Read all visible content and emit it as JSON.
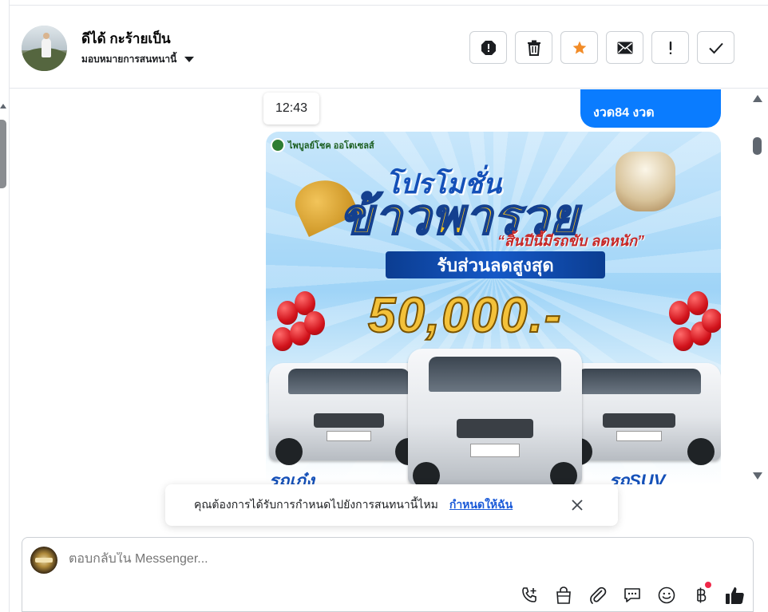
{
  "header": {
    "contact_name": "ดีได้ กะร้ายเป็น",
    "assign_label": "มอบหมายการสนทนานี้",
    "actions": [
      {
        "name": "block",
        "icon": "stop-octagon-icon"
      },
      {
        "name": "delete",
        "icon": "trash-icon"
      },
      {
        "name": "star",
        "icon": "star-icon"
      },
      {
        "name": "mark-unread",
        "icon": "envelope-icon"
      },
      {
        "name": "spam",
        "icon": "exclamation-icon"
      },
      {
        "name": "done",
        "icon": "check-icon"
      }
    ]
  },
  "conversation": {
    "timestamp": "12:43",
    "outgoing_message": "งวด84 งวด",
    "promo": {
      "brand": "ไพบูลย์โชค ออโตเซลส์",
      "title_a": "โปรโมชั่น",
      "title_b": "ข้าวพารวย",
      "subtitle": "“สิ้นปีนี้มีรถขับ ลดหนัก”",
      "band": "รับส่วนลดสูงสุด",
      "amount": "50,000.-",
      "label_left": "รถเก๋ง",
      "label_right": "รถSUV"
    }
  },
  "toast": {
    "text": "คุณต้องการได้รับการกำหนดไปยังการสนทนานี้ไหม",
    "link": "กำหนดให้ฉัน"
  },
  "composer": {
    "placeholder": "ตอบกลับใน Messenger...",
    "tools": [
      "call-add-icon",
      "shopping-bag-icon",
      "paperclip-icon",
      "chat-bubble-icon",
      "smiley-icon",
      "baht-icon",
      "thumbs-up-icon"
    ]
  },
  "colors": {
    "accent": "#0a7cff",
    "star": "#f28c28",
    "link": "#1a5ad8"
  }
}
